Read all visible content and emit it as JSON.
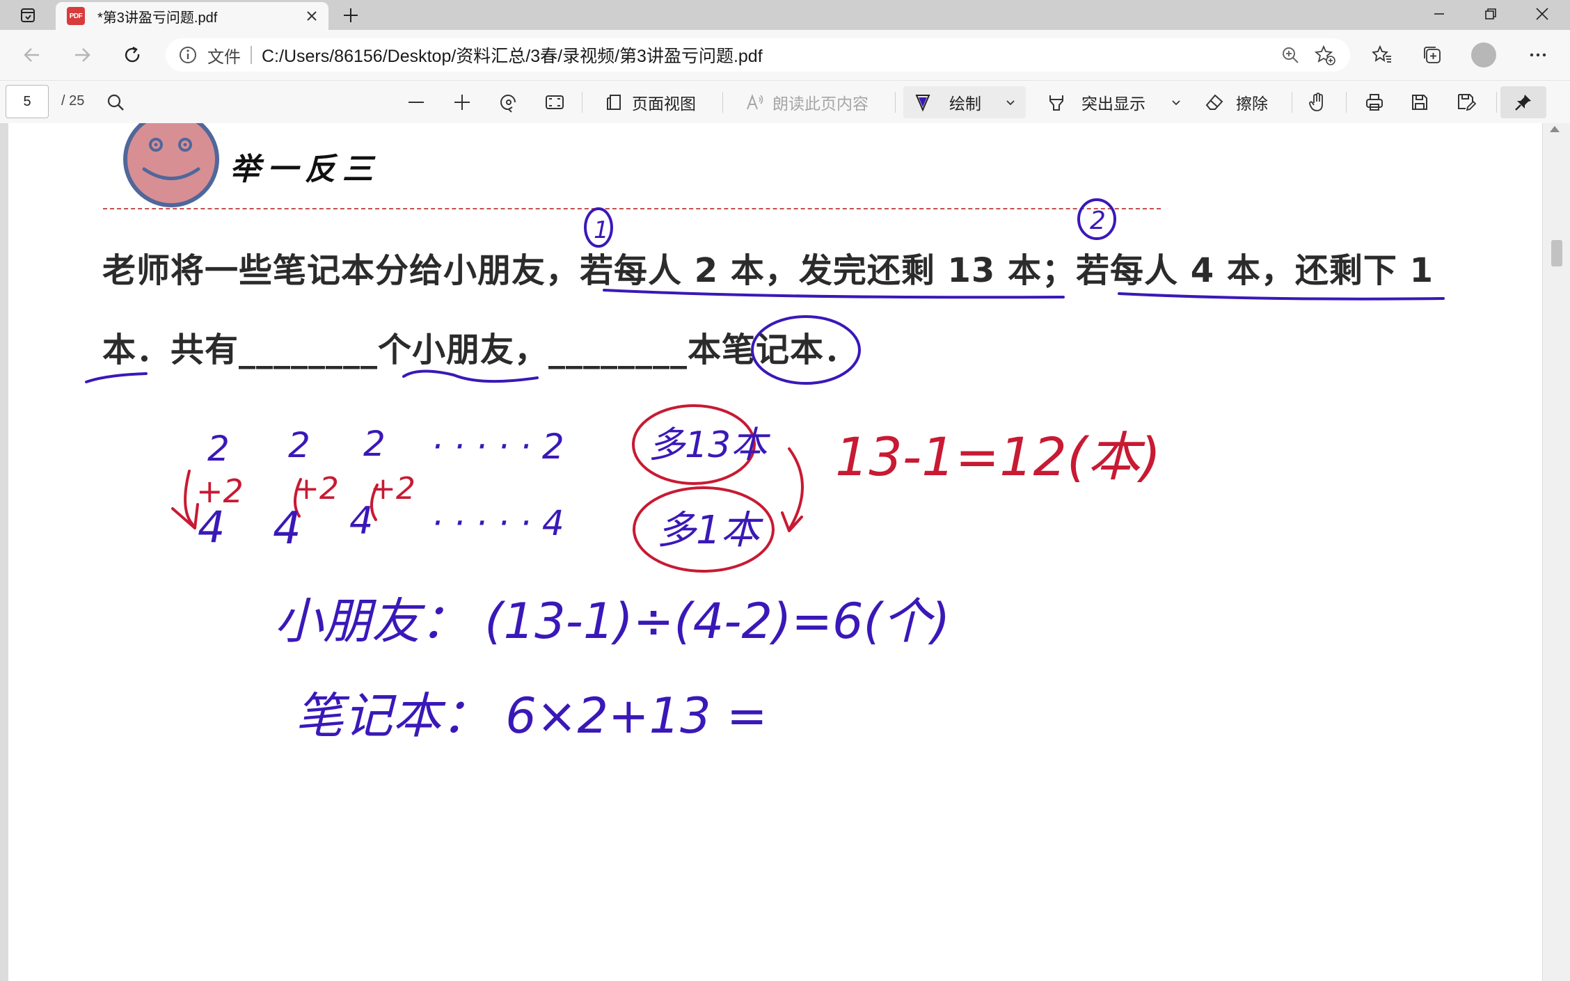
{
  "browser": {
    "tab_title": "*第3讲盈亏问题.pdf",
    "tab_icon_label": "PDF",
    "address": {
      "scheme_label": "文件",
      "url": "C:/Users/86156/Desktop/资料汇总/3春/录视频/第3讲盈亏问题.pdf"
    }
  },
  "pdf_toolbar": {
    "page_current": "5",
    "page_total": "/ 25",
    "page_view_label": "页面视图",
    "read_aloud_label": "朗读此页内容",
    "draw_label": "绘制",
    "highlight_label": "突出显示",
    "erase_label": "擦除",
    "accent_color": "#2e55c8"
  },
  "document": {
    "section_heading": "举一反三",
    "problem_line1": "老师将一些笔记本分给小朋友，若每人 2 本，发完还剩 13 本；若每人 4 本，还剩下 1",
    "problem_line2": "本．共有________个小朋友，________本笔记本．",
    "annotations": {
      "circle_1": "1",
      "circle_2": "2",
      "row1": [
        "2",
        "2",
        "2",
        "· · · · · 2"
      ],
      "steps": [
        "+2",
        "+2",
        "+2"
      ],
      "row2": [
        "4",
        "4",
        "4",
        "· · · · · 4"
      ],
      "extra_13": "多13本",
      "extra_1": "多1本",
      "diff_eq": "13-1=12(本)",
      "children_eq": "小朋友：  (13-1)÷(4-2)=6(个)",
      "notebooks_eq": "笔记本：  6×2+13 =",
      "ink_blue": "#3a18b8",
      "ink_red": "#c81a33"
    }
  }
}
